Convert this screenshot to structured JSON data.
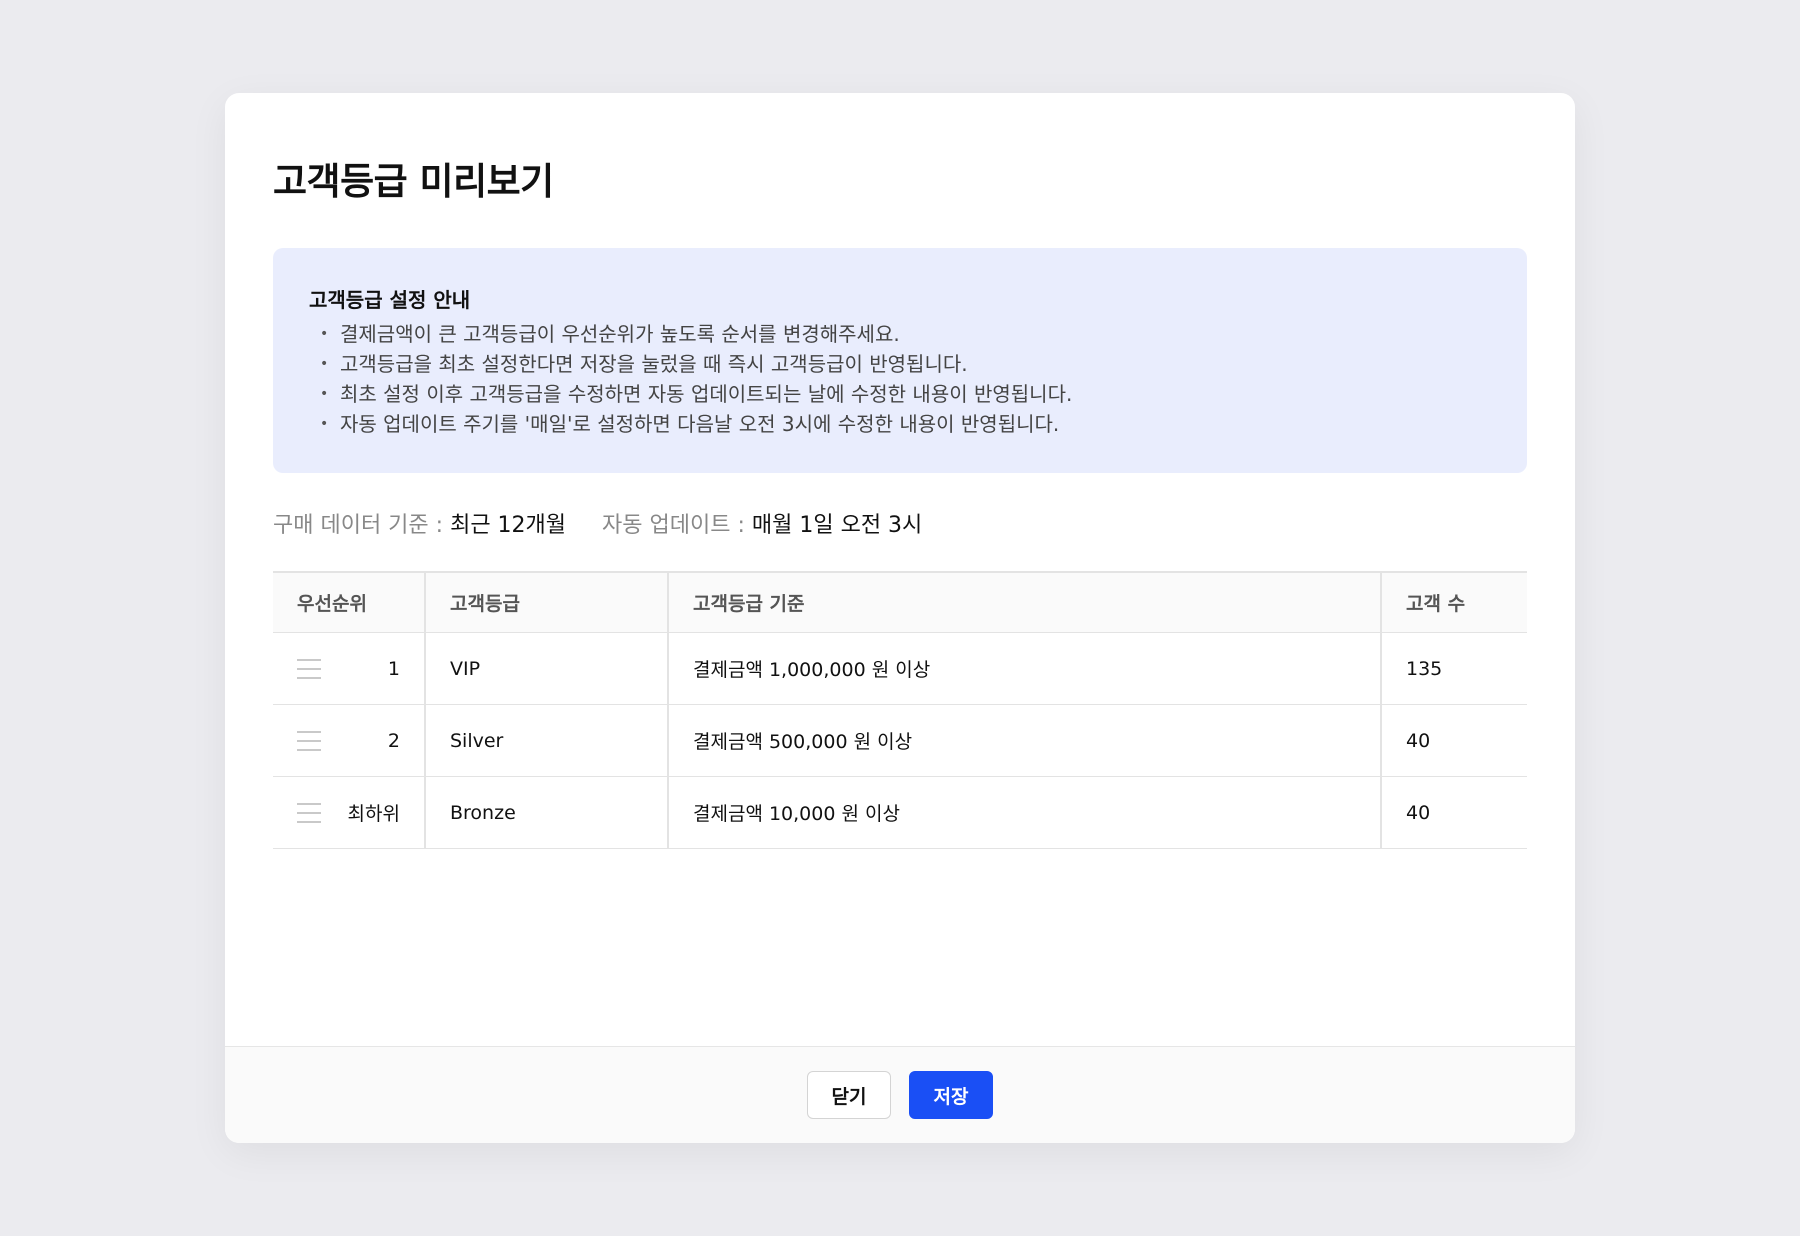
{
  "modal": {
    "title": "고객등급 미리보기"
  },
  "notice": {
    "title": "고객등급 설정 안내",
    "items": [
      "결제금액이 큰 고객등급이 우선순위가 높도록 순서를 변경해주세요.",
      "고객등급을 최초 설정한다면 저장을 눌렀을 때 즉시 고객등급이 반영됩니다.",
      "최초 설정 이후 고객등급을 수정하면 자동 업데이트되는 날에 수정한 내용이 반영됩니다.",
      "자동 업데이트 주기를 '매일'로 설정하면 다음날 오전 3시에 수정한 내용이 반영됩니다."
    ]
  },
  "meta": {
    "purchase_label": "구매 데이터 기준 : ",
    "purchase_value": "최근 12개월",
    "update_label": "자동 업데이트 : ",
    "update_value": "매월 1일 오전 3시"
  },
  "table": {
    "headers": [
      "우선순위",
      "고객등급",
      "고객등급 기준",
      "고객 수"
    ],
    "rows": [
      {
        "priority": "1",
        "grade": "VIP",
        "criteria": "결제금액 1,000,000 원 이상",
        "count": "135"
      },
      {
        "priority": "2",
        "grade": "Silver",
        "criteria": "결제금액 500,000 원 이상",
        "count": "40"
      },
      {
        "priority": "최하위",
        "grade": "Bronze",
        "criteria": "결제금액 10,000 원 이상",
        "count": "40"
      }
    ]
  },
  "footer": {
    "close_label": "닫기",
    "save_label": "저장"
  },
  "colors": {
    "accent": "#1a4ff5",
    "notice_bg": "#e9edfd"
  },
  "icons": {
    "drag_handle": "drag-handle-icon"
  }
}
